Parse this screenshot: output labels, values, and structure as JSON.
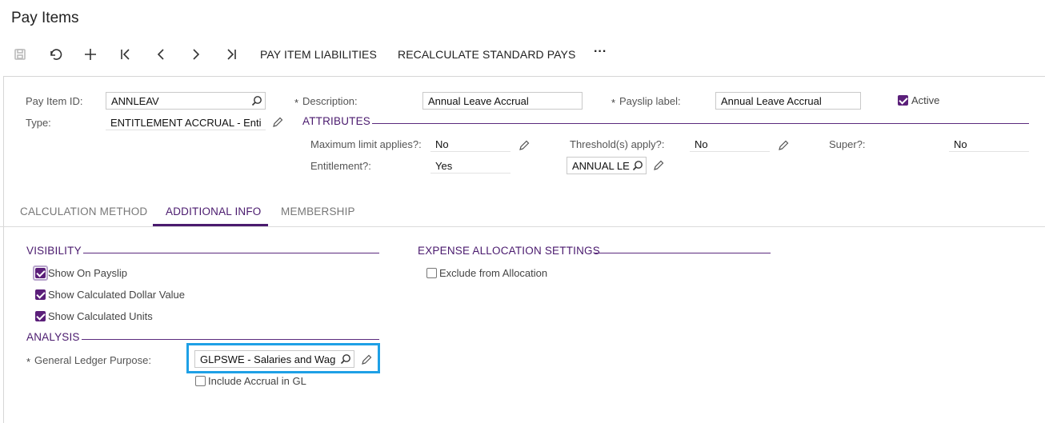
{
  "page": {
    "title": "Pay Items"
  },
  "toolbar": {
    "liabilities_label": "PAY ITEM LIABILITIES",
    "recalculate_label": "RECALCULATE STANDARD PAYS",
    "more_label": "···"
  },
  "form": {
    "pay_item_id": {
      "label": "Pay Item ID:",
      "value": "ANNLEAV"
    },
    "type": {
      "label": "Type:",
      "value": "ENTITLEMENT ACCRUAL - Enti"
    },
    "description": {
      "required": "*",
      "label": "Description:",
      "value": "Annual Leave Accrual"
    },
    "payslip_label": {
      "required": "*",
      "label": "Payslip label:",
      "value": "Annual Leave Accrual"
    },
    "active": {
      "label": "Active",
      "checked": true
    }
  },
  "attributes": {
    "heading": "ATTRIBUTES",
    "max_limit": {
      "label": "Maximum limit applies?:",
      "value": "No"
    },
    "entitlement": {
      "label": "Entitlement?:",
      "value": "Yes",
      "code": "ANNUAL LE"
    },
    "threshold": {
      "label": "Threshold(s) apply?:",
      "value": "No"
    },
    "super": {
      "label": "Super?:",
      "value": "No"
    }
  },
  "tabs": [
    {
      "label": "CALCULATION METHOD",
      "active": false
    },
    {
      "label": "ADDITIONAL INFO",
      "active": true
    },
    {
      "label": "MEMBERSHIP",
      "active": false
    }
  ],
  "visibility": {
    "heading": "VISIBILITY",
    "show_on_payslip": {
      "label": "Show On Payslip",
      "checked": true
    },
    "show_dollar": {
      "label": "Show Calculated Dollar Value",
      "checked": true
    },
    "show_units": {
      "label": "Show Calculated Units",
      "checked": true
    }
  },
  "expense": {
    "heading": "EXPENSE ALLOCATION SETTINGS",
    "exclude": {
      "label": "Exclude from Allocation",
      "checked": false
    }
  },
  "analysis": {
    "heading": "ANALYSIS",
    "gl_purpose": {
      "required": "*",
      "label": "General Ledger Purpose:",
      "value": "GLPSWE - Salaries and Wag"
    },
    "include_accrual": {
      "label": "Include Accrual in GL",
      "checked": false
    }
  },
  "colors": {
    "accent": "#4a1a6e",
    "checkbox": "#5b1f7a",
    "focus": "#1ea0e6"
  },
  "icons": [
    "save-icon",
    "undo-icon",
    "add-icon",
    "first-icon",
    "prev-icon",
    "next-icon",
    "last-icon",
    "more-icon",
    "search-icon",
    "pencil-icon"
  ]
}
